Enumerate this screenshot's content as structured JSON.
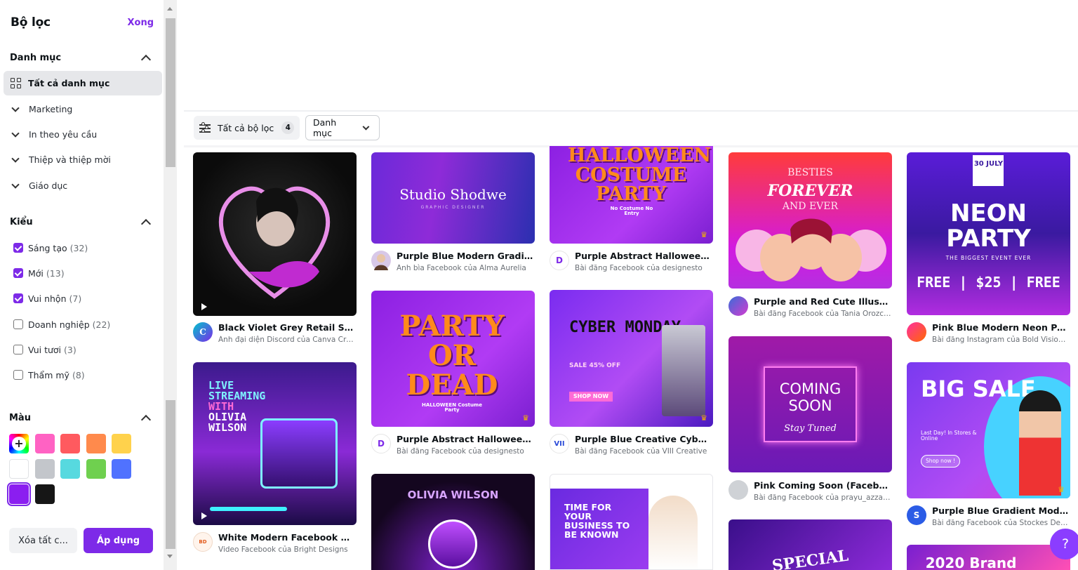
{
  "sidebar": {
    "title": "Bộ lọc",
    "done": "Xong",
    "category": {
      "title": "Danh mục",
      "items": [
        "Tất cả danh mục",
        "Marketing",
        "In theo yêu cầu",
        "Thiệp và thiệp mời",
        "Giáo dục"
      ]
    },
    "style": {
      "title": "Kiểu",
      "items": [
        {
          "label": "Sáng tạo",
          "count": "(32)",
          "checked": true
        },
        {
          "label": "Mới",
          "count": "(13)",
          "checked": true
        },
        {
          "label": "Vui nhộn",
          "count": "(7)",
          "checked": true
        },
        {
          "label": "Doanh nghiệp",
          "count": "(22)",
          "checked": false
        },
        {
          "label": "Vui tươi",
          "count": "(3)",
          "checked": false
        },
        {
          "label": "Thẩm mỹ",
          "count": "(8)",
          "checked": false
        }
      ]
    },
    "color": {
      "title": "Màu",
      "swatches": [
        "#ff62c3",
        "#ff5a5f",
        "#ff8a4c",
        "#ffd24c",
        "#ffffff",
        "#c3c6cb",
        "#57d9df",
        "#6fd04f",
        "#5072ff",
        "#8b1ef0",
        "#161616"
      ]
    },
    "clear_label": "Xóa tất c...",
    "apply_label": "Áp dụng"
  },
  "toolbar": {
    "filters_label": "Tất cả bộ lọc",
    "filters_count": "4",
    "category_select": "Danh mục"
  },
  "results": [
    {
      "title": "Black Violet Grey Retail Soft G...",
      "subtitle": "Ảnh đại diện Discord của Canva Crea..."
    },
    {
      "title": "White Modern Facebook Video",
      "subtitle": "Video Facebook của Bright Designs"
    },
    {
      "title": "Purple Blue Modern Gradient ...",
      "subtitle": "Ảnh bìa Facebook của Alma Aurelia",
      "thumb": "Studio Shodwe",
      "thumb_sub": "GRAPHIC DESIGNER"
    },
    {
      "title": "Purple Abstract Halloween Co...",
      "subtitle": "Bài đăng Facebook của designesto",
      "thumb": "PARTY OR DEAD",
      "thumb_sub": "HALLOWEEN Costume Party"
    },
    {
      "title": "",
      "subtitle": "",
      "thumb": "OLIVIA WILSON"
    },
    {
      "title": "Purple Abstract Halloween Co...",
      "subtitle": "Bài đăng Facebook của designesto",
      "thumb": "HALLOWEEN COSTUME PARTY",
      "thumb_sub": "No Costume No Entry"
    },
    {
      "title": "Purple Blue Creative Cyber M...",
      "subtitle": "Bài đăng Facebook của VIII Creative",
      "thumb": "CYBER MONDAY",
      "thumb_sub": "SALE 45% OFF",
      "thumb_btn": "SHOP NOW"
    },
    {
      "title": "",
      "subtitle": "",
      "thumb": "TIME FOR YOUR BUSINESS TO BE KNOWN"
    },
    {
      "title": "Purple and Red Cute Illustrat...",
      "subtitle": "Bài đăng Facebook của Tania Orozco...",
      "thumb_top": "BESTIES",
      "thumb": "FOREVER",
      "thumb_sub": "AND EVER"
    },
    {
      "title": "Pink Coming Soon (Facebook ...",
      "subtitle": "Bài đăng Facebook của prayu_azzahra",
      "thumb": "COMING SOON",
      "thumb_sub": "Stay Tuned"
    },
    {
      "title": "",
      "subtitle": "",
      "thumb": "SPECIAL"
    },
    {
      "title": "Pink Blue Modern Neon Party...",
      "subtitle": "Bài đăng Instagram của Bold Vision ...",
      "thumb_top": "30 JULY",
      "thumb": "NEON PARTY",
      "thumb_sub": "THE BIGGEST EVENT EVER"
    },
    {
      "title": "Purple Blue Gradient Modern ...",
      "subtitle": "Bài đăng Facebook của Stockes Desi...",
      "thumb": "BIG SALE",
      "thumb_sub": "Last Day! In Stores & Online",
      "thumb_btn": "Shop now !"
    },
    {
      "title": "",
      "subtitle": "",
      "thumb": "2020 Brand"
    }
  ],
  "help_label": "?"
}
